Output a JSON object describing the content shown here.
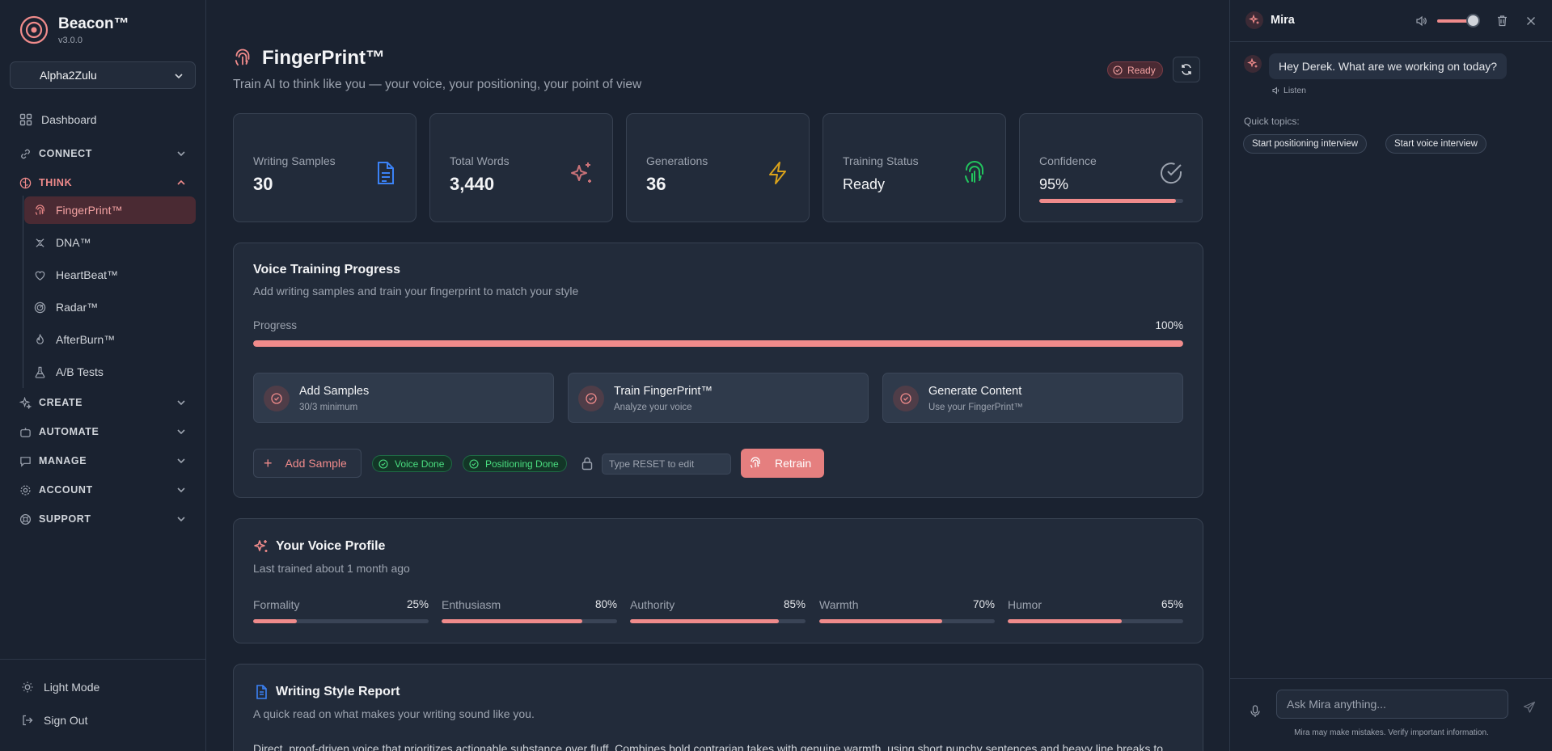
{
  "app": {
    "name": "Beacon™",
    "version": "v3.0.0",
    "accent": "#f08b8b"
  },
  "workspace": {
    "selected": "Alpha2Zulu"
  },
  "nav": {
    "dashboard": "Dashboard",
    "connect": "CONNECT",
    "think": "THINK",
    "think_items": [
      "FingerPrint™",
      "DNA™",
      "HeartBeat™",
      "Radar™",
      "AfterBurn™",
      "A/B Tests"
    ],
    "create": "CREATE",
    "automate": "AUTOMATE",
    "manage": "MANAGE",
    "account": "ACCOUNT",
    "support": "SUPPORT",
    "light_mode": "Light Mode",
    "sign_out": "Sign Out"
  },
  "page": {
    "title": "FingerPrint™",
    "subtitle": "Train AI to think like you — your voice, your positioning, your point of view",
    "status_badge": "Ready"
  },
  "stats": [
    {
      "label": "Writing Samples",
      "value": "30",
      "icon": "document-icon"
    },
    {
      "label": "Total Words",
      "value": "3,440",
      "icon": "sparkles-icon"
    },
    {
      "label": "Generations",
      "value": "36",
      "icon": "lightning-icon"
    },
    {
      "label": "Training Status",
      "value": "Ready",
      "icon": "fingerprint-icon"
    },
    {
      "label": "Confidence",
      "value": "95%",
      "icon": "check-circle-icon",
      "progress": 0.95
    }
  ],
  "training": {
    "title": "Voice Training Progress",
    "subtitle": "Add writing samples and train your fingerprint to match your style",
    "progress_label": "Progress",
    "progress_pct": "100%",
    "progress": 1.0,
    "steps": [
      {
        "title": "Add Samples",
        "sub": "30/3 minimum"
      },
      {
        "title": "Train FingerPrint™",
        "sub": "Analyze your voice"
      },
      {
        "title": "Generate Content",
        "sub": "Use your FingerPrint™"
      }
    ],
    "add_sample": "Add Sample",
    "voice_done": "Voice Done",
    "positioning_done": "Positioning Done",
    "reset_placeholder": "Type RESET to edit",
    "retrain": "Retrain"
  },
  "voice_profile": {
    "title": "Your Voice Profile",
    "subtitle": "Last trained about 1 month ago",
    "traits": [
      {
        "name": "Formality",
        "pct": "25%",
        "value": 0.25
      },
      {
        "name": "Enthusiasm",
        "pct": "80%",
        "value": 0.8
      },
      {
        "name": "Authority",
        "pct": "85%",
        "value": 0.85
      },
      {
        "name": "Warmth",
        "pct": "70%",
        "value": 0.7
      },
      {
        "name": "Humor",
        "pct": "65%",
        "value": 0.65
      }
    ]
  },
  "report": {
    "title": "Writing Style Report",
    "subtitle": "A quick read on what makes your writing sound like you.",
    "text": "Direct, proof-driven voice that prioritizes actionable substance over fluff. Combines bold contrarian takes with genuine warmth, using short punchy sentences and heavy line breaks to"
  },
  "chat": {
    "name": "Mira",
    "volume": 0.8,
    "greeting": "Hey Derek. What are we working on today?",
    "listen": "Listen",
    "quick_topics_label": "Quick topics:",
    "quick_topics": [
      "Start positioning interview",
      "Start voice interview"
    ],
    "input_placeholder": "Ask Mira anything...",
    "disclaimer": "Mira may make mistakes. Verify important information."
  }
}
